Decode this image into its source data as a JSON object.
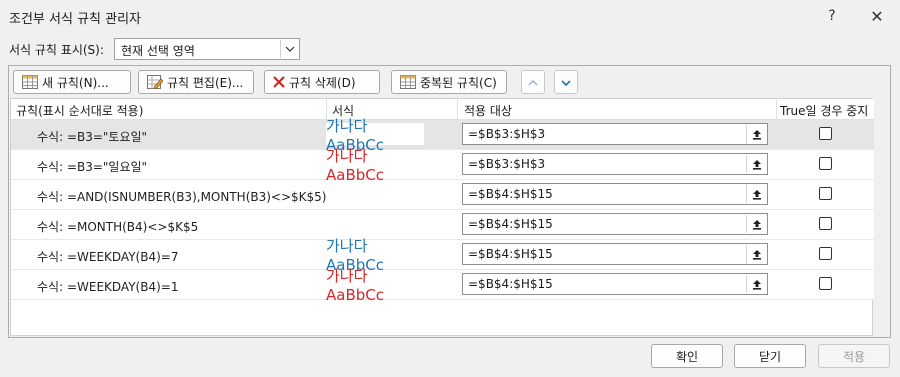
{
  "window": {
    "title": "조건부 서식 규칙 관리자",
    "help_label": "?",
    "close_label": "✕"
  },
  "show_rules": {
    "label": "서식 규칙 표시(S):",
    "value": "현재 선택 영역"
  },
  "toolbar": {
    "new_rule": "새 규칙(N)...",
    "edit_rule": "규칙 편집(E)...",
    "delete_rule": "규칙 삭제(D)",
    "duplicate_rule": "중복된 규칙(C)"
  },
  "columns": {
    "rule": "규칙(표시 순서대로 적용)",
    "format": "서식",
    "applies_to": "적용 대상",
    "stop_if_true": "True일 경우 중지"
  },
  "rules": [
    {
      "condition": "수식: =B3=\"토요일\"",
      "preview": "가나다AaBbCc",
      "preview_color": "#1f77b4",
      "applies_to": "=$B$3:$H$3",
      "stop_if_true": false
    },
    {
      "condition": "수식: =B3=\"일요일\"",
      "preview": "가나다AaBbCc",
      "preview_color": "#d62728",
      "applies_to": "=$B$3:$H$3",
      "stop_if_true": false
    },
    {
      "condition": "수식: =AND(ISNUMBER(B3),MONTH(B3)<>$K$5)",
      "preview": "",
      "preview_color": "",
      "applies_to": "=$B$4:$H$15",
      "stop_if_true": false
    },
    {
      "condition": "수식: =MONTH(B4)<>$K$5",
      "preview": "",
      "preview_color": "",
      "applies_to": "=$B$4:$H$15",
      "stop_if_true": false
    },
    {
      "condition": "수식: =WEEKDAY(B4)=7",
      "preview": "가나다AaBbCc",
      "preview_color": "#1f77b4",
      "applies_to": "=$B$4:$H$15",
      "stop_if_true": false
    },
    {
      "condition": "수식: =WEEKDAY(B4)=1",
      "preview": "가나다AaBbCc",
      "preview_color": "#d62728",
      "applies_to": "=$B$4:$H$15",
      "stop_if_true": false
    }
  ],
  "buttons": {
    "ok": "확인",
    "close": "닫기",
    "apply": "적용"
  }
}
